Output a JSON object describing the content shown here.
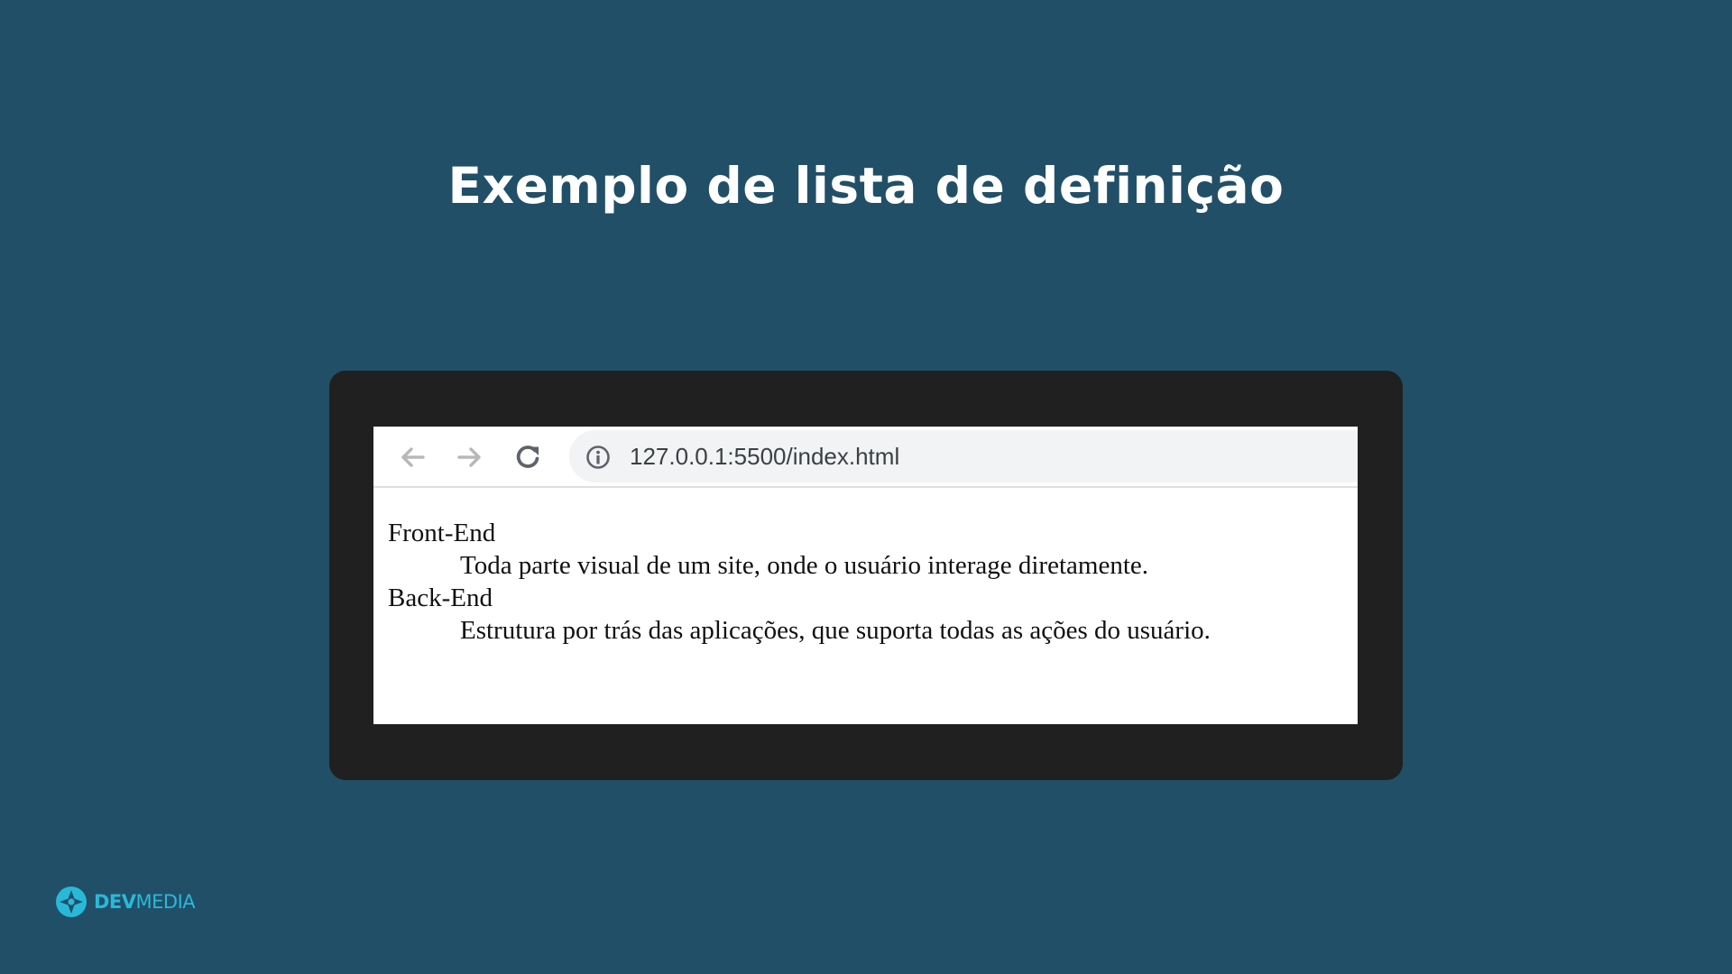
{
  "slide": {
    "title": "Exemplo de lista de definição"
  },
  "browser": {
    "url": "127.0.0.1:5500/index.html",
    "icons": {
      "back": "arrow-left-icon",
      "forward": "arrow-right-icon",
      "reload": "reload-icon",
      "site_info": "info-icon"
    }
  },
  "definition_list": [
    {
      "term": "Front-End",
      "description": "Toda parte visual de um site, onde o usuário interage diretamente."
    },
    {
      "term": "Back-End",
      "description": "Estrutura por trás das aplicações, que suporta todas as ações do usuário."
    }
  ],
  "brand": {
    "name_bold": "DEV",
    "name_light": "MEDIA"
  },
  "colors": {
    "background": "#214f68",
    "frame": "#202020",
    "brand_accent": "#29b9d8"
  }
}
